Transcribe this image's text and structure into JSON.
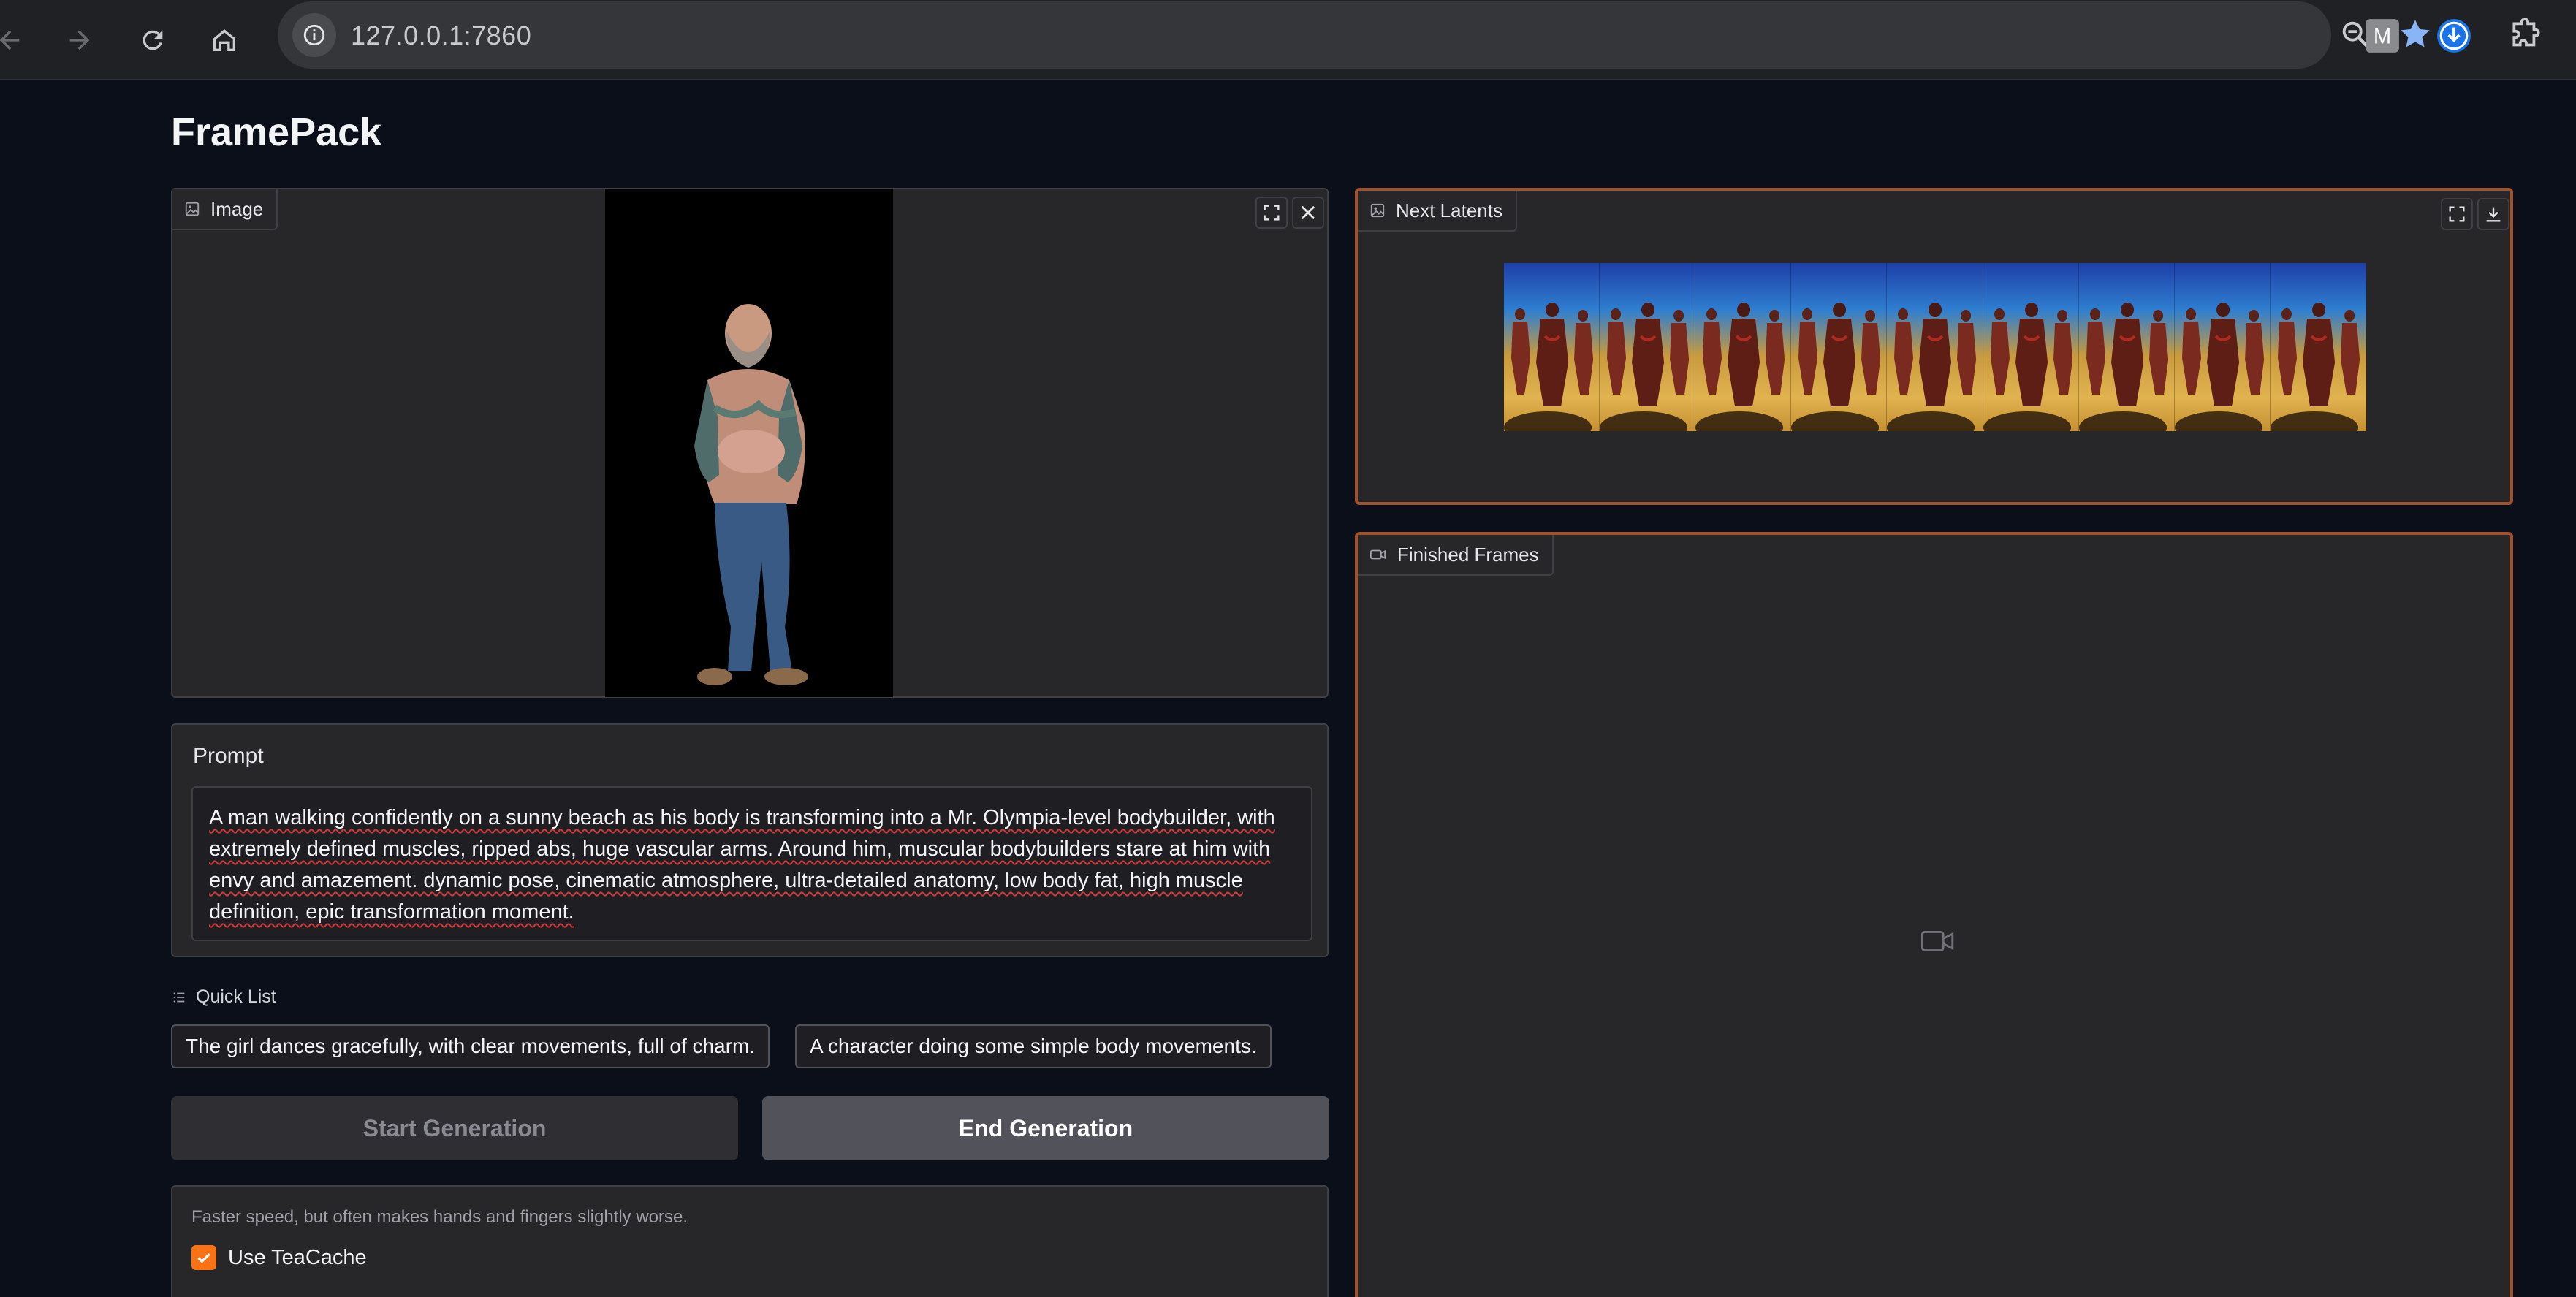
{
  "browser": {
    "url": "127.0.0.1:7860",
    "extension_m_label": "M"
  },
  "app": {
    "title": "FramePack"
  },
  "image_panel": {
    "label": "Image"
  },
  "latents_panel": {
    "label": "Next Latents",
    "frame_count": 9
  },
  "frames_panel": {
    "label": "Finished Frames"
  },
  "prompt": {
    "label": "Prompt",
    "text": "A man walking confidently on a sunny beach as his body is transforming into a Mr. Olympia-level bodybuilder, with extremely defined muscles, ripped abs, huge vascular arms. Around him, muscular bodybuilders  stare at him with envy and amazement.  dynamic pose, cinematic atmosphere, ultra-detailed anatomy, low body fat, high muscle definition, epic transformation moment."
  },
  "quick_list": {
    "label": "Quick List",
    "items": [
      "The girl dances gracefully, with clear movements, full of charm.",
      "A character doing some simple body movements."
    ]
  },
  "actions": {
    "start_label": "Start Generation",
    "end_label": "End Generation"
  },
  "teacache": {
    "hint": "Faster speed, but often makes hands and fingers slightly worse.",
    "label": "Use TeaCache",
    "checked": true
  },
  "colors": {
    "accent": "#f97316",
    "pending_border": "#a0522d",
    "background": "#0b0f19",
    "panel": "#27272a"
  }
}
